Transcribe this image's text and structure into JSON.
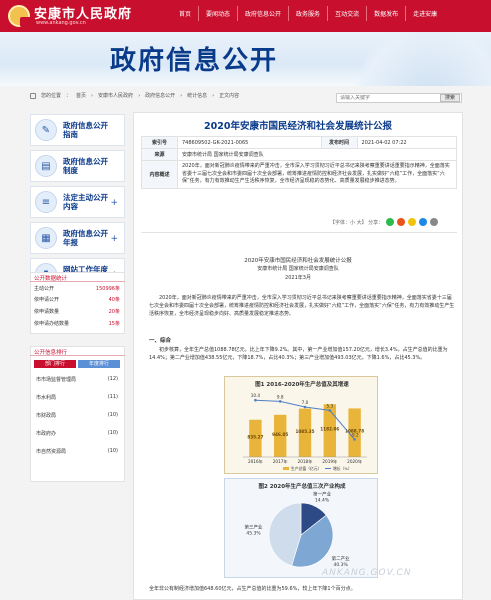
{
  "header": {
    "site_name": "安康市人民政府",
    "site_url": "www.ankang.gov.cn",
    "nav": [
      "首页",
      "要闻动态",
      "政府信息公开",
      "政务服务",
      "互动交流",
      "数据发布",
      "走进安康"
    ]
  },
  "banner": {
    "title": "政府信息公开"
  },
  "breadcrumb": {
    "label": "您的位置",
    "items": [
      "首页",
      "安康市人民政府",
      "政府信息公开",
      "统计信息",
      "正文内容"
    ]
  },
  "search": {
    "placeholder": "请输入关键字",
    "button": "搜索"
  },
  "sidebar": {
    "items": [
      {
        "label": "政府信息公开指南",
        "icon": "guide-icon",
        "plus": false
      },
      {
        "label": "政府信息公开制度",
        "icon": "policy-icon",
        "plus": false
      },
      {
        "label": "法定主动公开内容",
        "icon": "document-icon",
        "plus": true
      },
      {
        "label": "政府信息公开年报",
        "icon": "report-icon",
        "plus": true
      },
      {
        "label": "网站工作年度报表",
        "icon": "chart-icon",
        "plus": true
      }
    ]
  },
  "stats": {
    "title": "公开数据统计",
    "rows": [
      {
        "label": "主动公开",
        "value": "150996条"
      },
      {
        "label": "依申请公开",
        "value": "40条"
      },
      {
        "label": "依申请数量",
        "value": "20条"
      },
      {
        "label": "依申请办结数量",
        "value": "15条"
      }
    ]
  },
  "ranking": {
    "title": "公开信息排行",
    "tabs": [
      "部门排行",
      "年度排行"
    ],
    "rows": [
      {
        "label": "市市场监督管理局",
        "value": "(12)"
      },
      {
        "label": "市水利局",
        "value": "(11)"
      },
      {
        "label": "市财政局",
        "value": "(10)"
      },
      {
        "label": "市政府办",
        "value": "(10)"
      },
      {
        "label": "市自然资源局",
        "value": "(10)"
      }
    ]
  },
  "doc": {
    "title": "2020年安康市国民经济和社会发展统计公报",
    "meta": {
      "index_label": "索引号",
      "index": "748609502-GK-2021-0065",
      "category_label": "发布机构",
      "category": "",
      "date_label": "发布时间",
      "date": "2021-04-02 07:22",
      "source_label": "来源",
      "source": "安康市统计局  国家统计局安康调查队",
      "summary_label": "内容概述",
      "summary": "2020年，面对新冠肺炎疫情带来的严重冲击，全市深入学习贯彻习近平总书记来陕考察重要讲话重要指示精神，全面落实省委十三届七次全会和市委四届十次全会部署，统筹推进疫情防控和经济社会发展，扎实做好“六稳”工作，全面落实“六保”任务，有力有效推动生产生活秩序恢复，全市经济呈现稳的态势化、高质量发展稳步推进态势。"
    },
    "share": "【字体：小 大】 分享："
  },
  "article": {
    "title": "2020年安康市国民经济和社会发展统计公报",
    "org": "安康市统计局  国家统计局安康调查队",
    "date": "2021年3月",
    "intro": "2020年，面对新冠肺炎疫情带来的严重冲击，全市深入学习贯彻习近平总书记来陕考察重要讲话重要指示精神，全面落实省委十三届七次全会和市委四届十次全会部署，统筹推进疫情防控和经济社会发展，扎实做好“六稳”工作，全面落实“六保”任务，有力有效推动生产生活秩序恢复，全市经济呈现稳步向好、高质量发展稳定推进态势。",
    "section1": "一、综合",
    "para1": "初步核算，全年生产总值1088.78亿元，比上年下降9.2%。其中，第一产业增加值157.20亿元，增长3.4%，占生产总值的比重为14.4%；第二产业增加值438.55亿元，下降18.7%，占比40.3%；第三产业增加值493.03亿元，下降1.6%，占比45.3%。",
    "footer": "全年非公有制经济增加值648.60亿元，占生产总值的比重为59.6%，较上年下降1个百分点。",
    "watermark": "ANKANG.GOV.CN"
  },
  "chart_data": [
    {
      "type": "bar",
      "title": "图1  2016-2020年生产总值及其增速",
      "categories": [
        "2016年",
        "2017年",
        "2018年",
        "2019年",
        "2020年"
      ],
      "series": [
        {
          "name": "生产总值（亿元）",
          "values": [
            835.27,
            946.05,
            1085.35,
            1182.06,
            1088.78
          ]
        },
        {
          "name": "增长（%）",
          "values": [
            10.4,
            9.8,
            7.0,
            5.3,
            -9.2
          ]
        }
      ]
    },
    {
      "type": "pie",
      "title": "图2  2020年生产总值三次产业构成",
      "labels": [
        "第一产业",
        "第二产业",
        "第三产业"
      ],
      "values": [
        14.4,
        40.3,
        45.3
      ]
    }
  ],
  "colors": {
    "brand": "#c8102e",
    "title": "#0a3a8a",
    "bar": "#e8b43a",
    "line": "#4f7fc5"
  }
}
